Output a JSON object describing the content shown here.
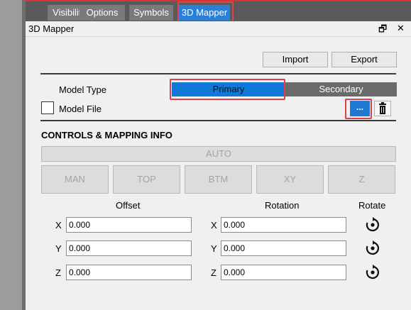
{
  "tabs": [
    "Visibility",
    "Options",
    "Symbols",
    "3D Mapper"
  ],
  "panel": {
    "title": "3D Mapper"
  },
  "toolbar": {
    "import_label": "Import",
    "export_label": "Export"
  },
  "model": {
    "type_label": "Model Type",
    "primary_label": "Primary",
    "secondary_label": "Secondary",
    "file_label": "Model File",
    "browse_label": "..."
  },
  "controls": {
    "title": "CONTROLS & MAPPING INFO",
    "auto_label": "AUTO",
    "modes": [
      "MAN",
      "TOP",
      "BTM",
      "XY",
      "Z"
    ]
  },
  "mapping": {
    "offset_label": "Offset",
    "rotation_label": "Rotation",
    "rotate_label": "Rotate",
    "axes": [
      "X",
      "Y",
      "Z"
    ],
    "offset_values": [
      "0.000",
      "0.000",
      "0.000"
    ],
    "rotation_values": [
      "0.000",
      "0.000",
      "0.000"
    ]
  },
  "colors": {
    "accent": "#1079d8",
    "highlight": "#e0404a",
    "secondary": "#6a6a6a"
  }
}
